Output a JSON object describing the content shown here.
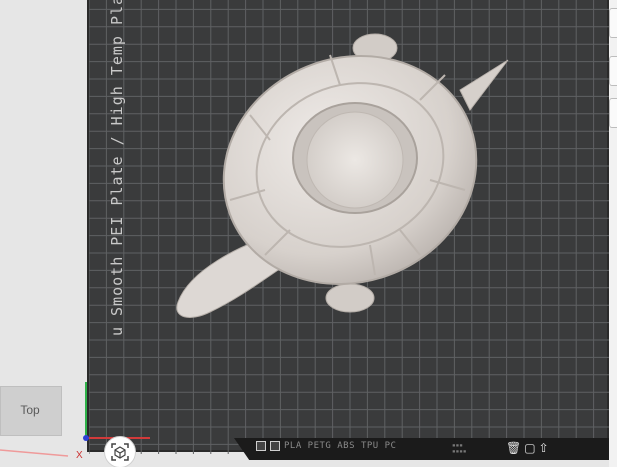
{
  "viewport": {
    "plate_label": "u Smooth PEI Plate / High Temp Plate",
    "filament_types": "PLA  PETG  ABS  TPU  PC",
    "camera_view": "Top",
    "x_axis": "X"
  },
  "colors": {
    "background": "#e6e6e6",
    "plate": "#3a3b3c",
    "grid_line": "#5f6163",
    "model": "#d8d3cf",
    "x_axis": "#d23a3a",
    "y_axis": "#2fb24a"
  },
  "icons": {
    "plate_left": [
      "plate-settings-icon",
      "plate-lock-icon"
    ],
    "plate_right": [
      "plate-delete-icon",
      "plate-arrange-icon",
      "plate-orient-icon"
    ],
    "recenter": "recenter-view-icon"
  }
}
